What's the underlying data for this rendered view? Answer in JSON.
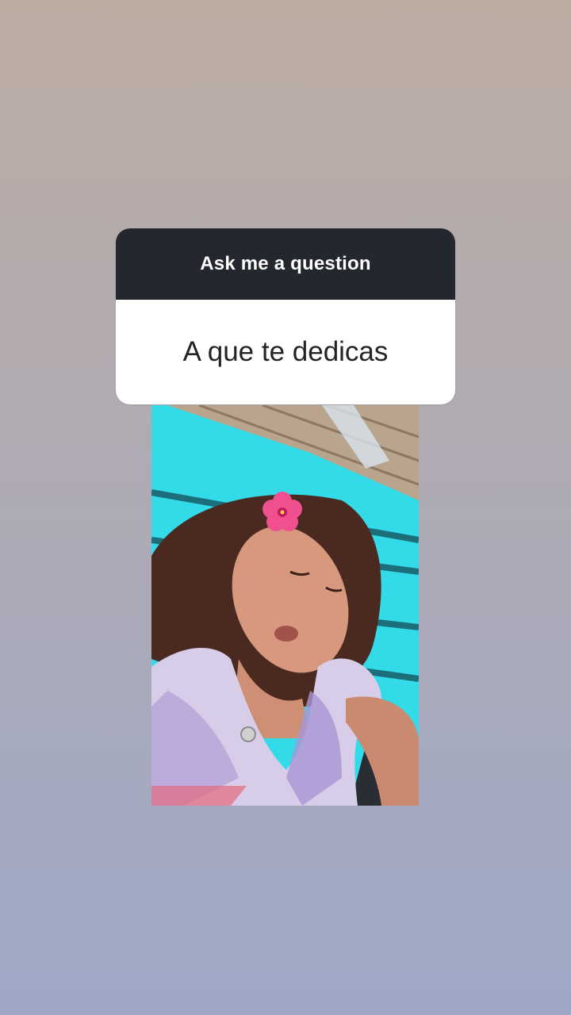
{
  "question_sticker": {
    "header_label": "Ask me a question",
    "question_text": "A que te dedicas"
  },
  "colors": {
    "background_top": "#bcaca2",
    "background_bottom": "#9ea8c6",
    "card_header": "#24272d",
    "card_body": "#ffffff",
    "bench_turquoise": "#2fd6e6",
    "flower_pink": "#f0508f"
  },
  "media": {
    "icon": "selfie-photo"
  }
}
